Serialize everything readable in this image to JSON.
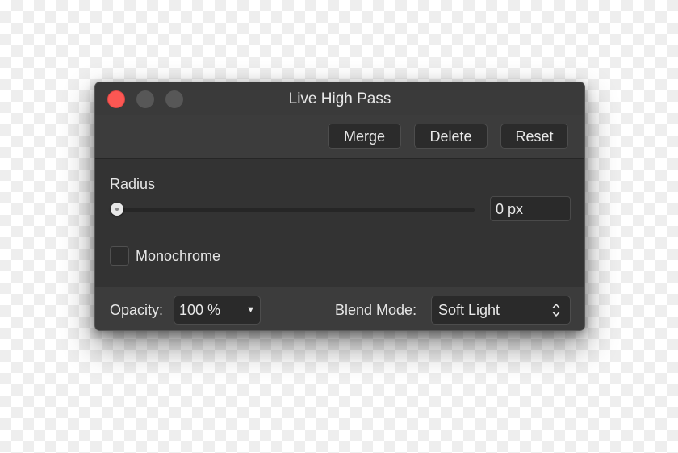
{
  "window": {
    "title": "Live High Pass"
  },
  "toolbar": {
    "merge_label": "Merge",
    "delete_label": "Delete",
    "reset_label": "Reset"
  },
  "radius": {
    "label": "Radius",
    "value": "0 px",
    "slider_fraction": 0
  },
  "monochrome": {
    "label": "Monochrome",
    "checked": false
  },
  "footer": {
    "opacity_label": "Opacity:",
    "opacity_value": "100 %",
    "blend_label": "Blend Mode:",
    "blend_value": "Soft Light"
  },
  "colors": {
    "window_bg": "#333333",
    "bar_bg": "#3c3c3c",
    "close": "#fc5753",
    "text": "#e8e8e8"
  },
  "icons": {
    "close": "close-dot-icon",
    "minimize": "minimize-dot-icon",
    "zoom": "zoom-dot-icon",
    "opacity_dropdown": "triangle-down-icon",
    "blend_dropdown": "up-down-chevrons-icon"
  }
}
